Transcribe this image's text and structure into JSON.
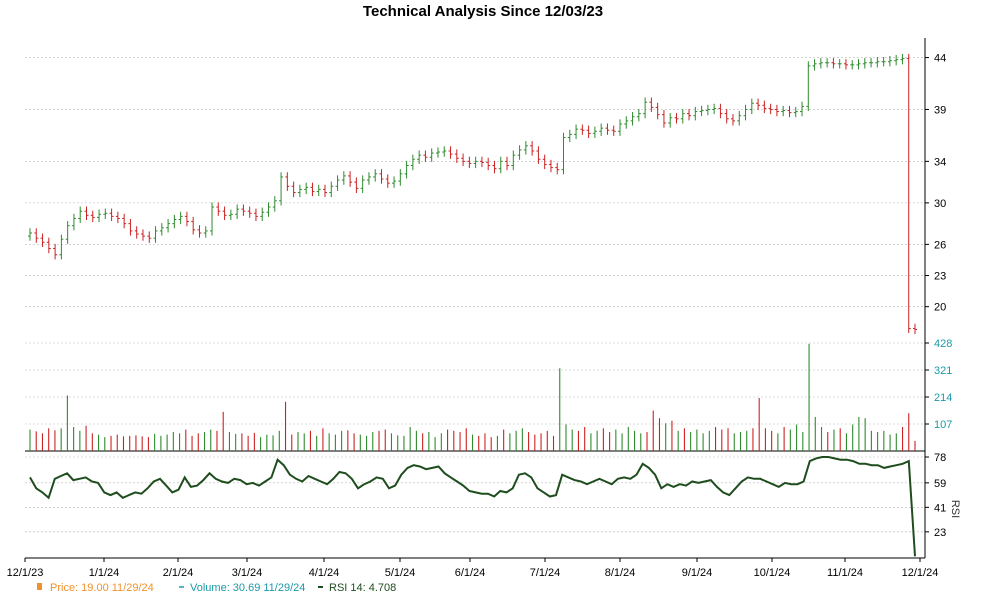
{
  "chart_data": {
    "type": "line",
    "title": "Technical Analysis Since 12/03/23",
    "x_tick_labels": [
      "12/1/23",
      "1/1/24",
      "2/1/24",
      "3/1/24",
      "4/1/24",
      "5/1/24",
      "6/1/24",
      "7/1/24",
      "8/1/24",
      "9/1/24",
      "10/1/24",
      "11/1/24",
      "12/1/24"
    ],
    "price_panel": {
      "ytick_labels": [
        "44",
        "39",
        "34",
        "30",
        "26",
        "23",
        "20"
      ],
      "ylim": [
        16.5,
        45.5
      ],
      "grid": true,
      "closes": [
        27.1,
        26.6,
        26.2,
        25.6,
        25.0,
        26.5,
        27.8,
        28.5,
        29.2,
        28.8,
        28.6,
        28.9,
        29.0,
        28.7,
        28.5,
        28.0,
        27.3,
        27.0,
        26.8,
        26.6,
        27.3,
        27.6,
        28.0,
        28.4,
        28.7,
        28.2,
        27.4,
        27.1,
        27.3,
        29.6,
        29.2,
        28.8,
        28.9,
        29.4,
        29.2,
        29.0,
        28.7,
        29.1,
        29.6,
        30.2,
        32.5,
        31.6,
        31.0,
        31.3,
        31.5,
        31.1,
        31.3,
        31.0,
        31.6,
        32.2,
        32.6,
        32.0,
        31.4,
        32.2,
        32.5,
        32.8,
        32.3,
        31.9,
        32.1,
        32.8,
        33.6,
        34.2,
        34.6,
        34.4,
        34.8,
        34.9,
        35.0,
        34.7,
        34.3,
        34.0,
        33.8,
        34.0,
        33.9,
        33.6,
        33.3,
        34.0,
        33.6,
        34.6,
        35.1,
        35.5,
        35.0,
        34.2,
        33.7,
        33.4,
        33.2,
        36.3,
        36.6,
        37.1,
        37.0,
        36.7,
        36.9,
        37.2,
        37.0,
        36.9,
        37.6,
        37.9,
        38.3,
        38.6,
        39.7,
        39.2,
        38.5,
        37.7,
        38.2,
        38.1,
        38.6,
        38.4,
        38.8,
        38.9,
        39.0,
        39.1,
        38.6,
        38.1,
        37.9,
        38.4,
        39.0,
        39.6,
        39.4,
        39.1,
        39.0,
        38.8,
        38.9,
        38.7,
        38.8,
        39.3,
        43.2,
        43.4,
        43.5,
        43.5,
        43.4,
        43.4,
        43.3,
        43.3,
        43.4,
        43.5,
        43.5,
        43.6,
        43.6,
        43.7,
        43.8,
        43.9,
        17.9,
        17.8
      ],
      "last_price": 19.0
    },
    "volume_panel": {
      "ytick_labels": [
        "428",
        "321",
        "214",
        "107"
      ],
      "ylim": [
        0,
        428
      ],
      "grid": true,
      "values": [
        85,
        78,
        70,
        90,
        82,
        90,
        220,
        95,
        80,
        100,
        70,
        65,
        55,
        60,
        65,
        58,
        60,
        62,
        58,
        55,
        68,
        60,
        65,
        75,
        70,
        85,
        60,
        70,
        75,
        85,
        80,
        155,
        75,
        68,
        70,
        60,
        72,
        55,
        65,
        62,
        80,
        195,
        65,
        75,
        70,
        80,
        60,
        90,
        70,
        65,
        80,
        82,
        70,
        65,
        60,
        75,
        80,
        85,
        70,
        62,
        60,
        95,
        80,
        70,
        75,
        55,
        70,
        85,
        80,
        75,
        90,
        65,
        60,
        70,
        55,
        60,
        85,
        70,
        80,
        90,
        75,
        65,
        70,
        80,
        60,
        328,
        105,
        85,
        80,
        95,
        70,
        80,
        90,
        75,
        85,
        70,
        95,
        80,
        70,
        75,
        160,
        130,
        110,
        120,
        80,
        90,
        75,
        85,
        70,
        80,
        95,
        85,
        90,
        70,
        75,
        80,
        90,
        210,
        90,
        80,
        70,
        95,
        85,
        105,
        75,
        425,
        135,
        95,
        75,
        85,
        90,
        70,
        105,
        135,
        130,
        80,
        75,
        80,
        65,
        70,
        95,
        150,
        40
      ],
      "last_value": 30.69
    },
    "rsi_panel": {
      "label": "RSI",
      "ytick_labels": [
        "78",
        "59",
        "41",
        "23"
      ],
      "ylim": [
        4.5,
        78
      ],
      "grid": true,
      "values": [
        63,
        55,
        52,
        48,
        62,
        64,
        66,
        61,
        62,
        63,
        60,
        59,
        52,
        50,
        52,
        48,
        50,
        52,
        51,
        55,
        60,
        62,
        57,
        52,
        54,
        63,
        56,
        57,
        61,
        66,
        62,
        60,
        59,
        62,
        61,
        58,
        59,
        57,
        60,
        63,
        76,
        72,
        65,
        62,
        60,
        64,
        62,
        60,
        58,
        62,
        67,
        66,
        62,
        55,
        58,
        60,
        63,
        62,
        55,
        57,
        65,
        70,
        72,
        71,
        69,
        70,
        71,
        66,
        63,
        60,
        57,
        53,
        52,
        51,
        51,
        49,
        53,
        52,
        55,
        65,
        66,
        63,
        55,
        52,
        49,
        50,
        65,
        63,
        61,
        60,
        58,
        60,
        62,
        60,
        58,
        62,
        63,
        62,
        65,
        73,
        70,
        65,
        55,
        58,
        56,
        58,
        57,
        60,
        59,
        60,
        61,
        56,
        52,
        50,
        55,
        60,
        63,
        62,
        62,
        60,
        58,
        56,
        59,
        58,
        58,
        60,
        75,
        77,
        78,
        78,
        77,
        76,
        76,
        75,
        73,
        73,
        72,
        72,
        70,
        71,
        72,
        73,
        75,
        5
      ],
      "last_value": 4.708
    }
  },
  "legend": {
    "price_text": "Price: 19.00  11/29/24",
    "volume_text": "Volume: 30.69  11/29/24",
    "rsi_text": "RSI 14: 4.708"
  },
  "colors": {
    "up": "#2e8b2e",
    "down": "#cc2222",
    "price_legend": "#f0922b",
    "volume_legend": "#1a9aa8",
    "rsi_line": "#1e4d1e",
    "grid": "#bbbbbb"
  }
}
